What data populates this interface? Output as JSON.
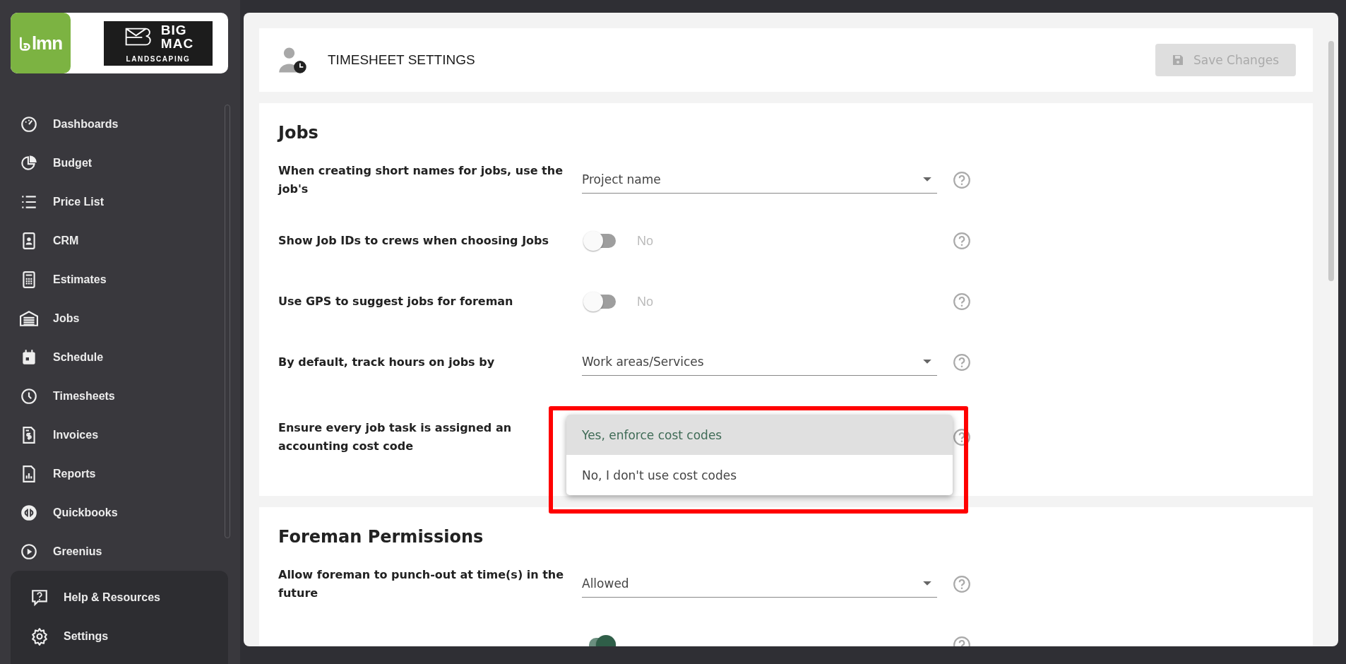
{
  "brand": {
    "app_logo": "lmn",
    "company_logo": {
      "line_1": "BIG",
      "line_2": "MAC",
      "line_3": "LANDSCAPING"
    }
  },
  "sidebar": {
    "items": [
      {
        "label": "Dashboards"
      },
      {
        "label": "Budget"
      },
      {
        "label": "Price List"
      },
      {
        "label": "CRM"
      },
      {
        "label": "Estimates"
      },
      {
        "label": "Jobs"
      },
      {
        "label": "Schedule"
      },
      {
        "label": "Timesheets"
      },
      {
        "label": "Invoices"
      },
      {
        "label": "Reports"
      },
      {
        "label": "Quickbooks"
      },
      {
        "label": "Greenius"
      }
    ],
    "footer_items": [
      {
        "label": "Help & Resources"
      },
      {
        "label": "Settings"
      }
    ]
  },
  "header": {
    "title": "TIMESHEET SETTINGS",
    "save_button": {
      "label": "Save Changes",
      "disabled": true
    }
  },
  "sections": [
    {
      "title": "Jobs",
      "rows": [
        {
          "kind": "select",
          "label": "When creating short names for jobs, use the job's",
          "value": "Project name"
        },
        {
          "kind": "toggle",
          "label": "Show Job IDs to crews when choosing Jobs",
          "on": false,
          "value": "No"
        },
        {
          "kind": "toggle",
          "label": "Use GPS to suggest jobs for foreman",
          "on": false,
          "value": "No"
        },
        {
          "kind": "select",
          "label": "By default, track hours on jobs by",
          "value": "Work areas/Services"
        },
        {
          "kind": "menu",
          "label": "Ensure every job task is assigned an accounting cost code",
          "highlighted": true,
          "options": [
            {
              "label": "Yes, enforce cost codes",
              "selected": true
            },
            {
              "label": "No, I don't use cost codes",
              "selected": false
            }
          ]
        }
      ]
    },
    {
      "title": "Foreman Permissions",
      "rows": [
        {
          "kind": "select",
          "label": "Allow foreman to punch-out at time(s) in the future",
          "value": "Allowed"
        },
        {
          "kind": "toggle",
          "on": true
        }
      ]
    }
  ]
}
